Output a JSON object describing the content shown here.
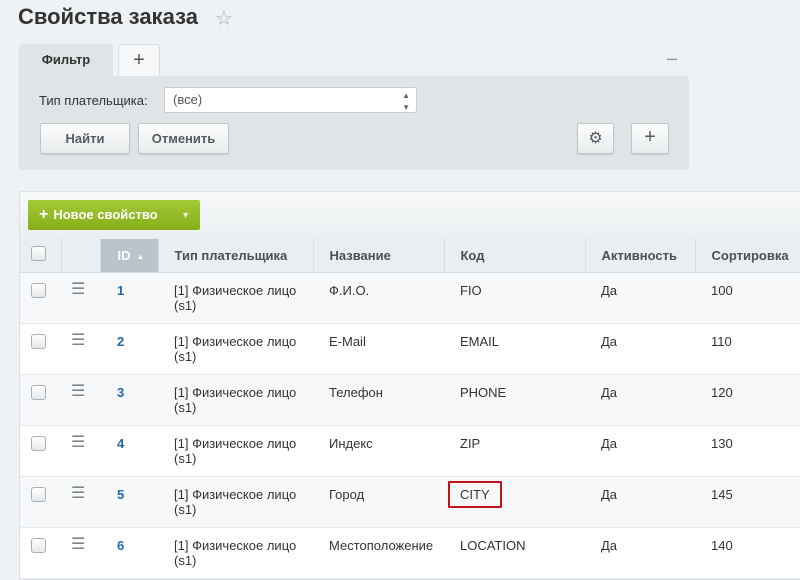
{
  "page": {
    "title": "Свойства заказа"
  },
  "filter": {
    "tab_label": "Фильтр",
    "add_tab_label": "+",
    "collapse_label": "–",
    "field_label": "Тип плательщика:",
    "field_value": "(все)",
    "find_label": "Найти",
    "cancel_label": "Отменить",
    "settings_icon": "gear-icon",
    "add_field_label": "+"
  },
  "toolbar": {
    "new_property_label": "Новое свойство"
  },
  "table": {
    "columns": [
      "ID",
      "Тип плательщика",
      "Название",
      "Код",
      "Активность",
      "Сортировка"
    ],
    "sorted_column": "ID",
    "rows": [
      {
        "id": "1",
        "payer_type": "[1] Физическое лицо (s1)",
        "name": "Ф.И.О.",
        "code": "FIO",
        "active": "Да",
        "sort": "100"
      },
      {
        "id": "2",
        "payer_type": "[1] Физическое лицо (s1)",
        "name": "E-Mail",
        "code": "EMAIL",
        "active": "Да",
        "sort": "110"
      },
      {
        "id": "3",
        "payer_type": "[1] Физическое лицо (s1)",
        "name": "Телефон",
        "code": "PHONE",
        "active": "Да",
        "sort": "120"
      },
      {
        "id": "4",
        "payer_type": "[1] Физическое лицо (s1)",
        "name": "Индекс",
        "code": "ZIP",
        "active": "Да",
        "sort": "130"
      },
      {
        "id": "5",
        "payer_type": "[1] Физическое лицо (s1)",
        "name": "Город",
        "code": "CITY",
        "active": "Да",
        "sort": "145"
      },
      {
        "id": "6",
        "payer_type": "[1] Физическое лицо (s1)",
        "name": "Местоположение",
        "code": "LOCATION",
        "active": "Да",
        "sort": "140"
      }
    ]
  },
  "colors": {
    "accent_green": "#8db721",
    "link_blue": "#2067b0",
    "highlight_red": "#c0141a"
  }
}
